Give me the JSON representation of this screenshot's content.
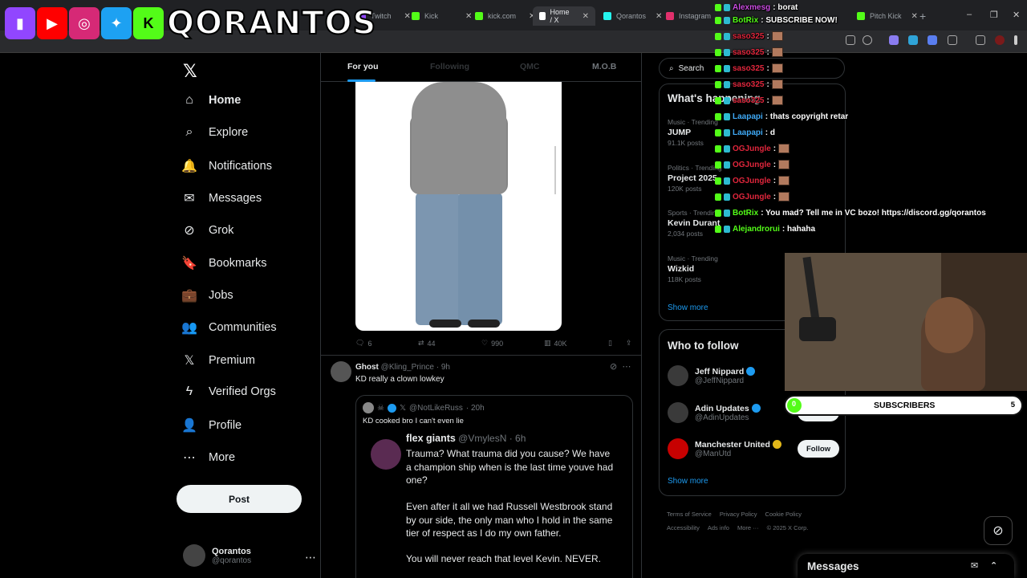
{
  "browser": {
    "tabs": [
      {
        "label": "Twitch",
        "color": "#9146ff"
      },
      {
        "label": "Kick",
        "color": "#53fc18"
      },
      {
        "label": "kick.com",
        "color": "#53fc18"
      },
      {
        "label": "Home / X",
        "color": "#ffffff"
      },
      {
        "label": "Qorantos",
        "color": "#25f4ee"
      },
      {
        "label": "Instagram",
        "color": "#e1306c"
      },
      {
        "label": "Pitch Kick",
        "color": "#53fc18"
      }
    ],
    "new_tab": "+",
    "window_controls": [
      "–",
      "❐",
      "✕"
    ]
  },
  "overlay": {
    "channel_name": "QORANTOS",
    "logos": [
      "twitch-logo",
      "youtube-logo",
      "instagram-logo",
      "twitter-logo",
      "kick-logo"
    ]
  },
  "nav": {
    "logo": "𝕏",
    "items": [
      {
        "label": "Home",
        "icon": "⌂"
      },
      {
        "label": "Explore",
        "icon": "⌕"
      },
      {
        "label": "Notifications",
        "icon": "🔔"
      },
      {
        "label": "Messages",
        "icon": "✉"
      },
      {
        "label": "Grok",
        "icon": "⊘"
      },
      {
        "label": "Bookmarks",
        "icon": "🔖"
      },
      {
        "label": "Jobs",
        "icon": "💼"
      },
      {
        "label": "Communities",
        "icon": "👥"
      },
      {
        "label": "Premium",
        "icon": "𝕏"
      },
      {
        "label": "Verified Orgs",
        "icon": "ϟ"
      },
      {
        "label": "Profile",
        "icon": "👤"
      },
      {
        "label": "More",
        "icon": "⋯"
      }
    ],
    "post_label": "Post",
    "account": {
      "name": "Qorantos",
      "handle": "@qorantos",
      "more": "⋯"
    }
  },
  "feed": {
    "tabs": [
      "For you",
      "Following",
      "QMC",
      "M.O.B"
    ],
    "media_actions": {
      "replies": "6",
      "reposts": "44",
      "likes": "990",
      "views": "40K"
    },
    "tweet": {
      "name": "Ghost",
      "handle": "@Kling_Prince",
      "time": "· 9h",
      "text": "KD really a clown lowkey",
      "quote": {
        "handle": "@NotLikeRuss",
        "time": "· 20h",
        "text": "KD cooked bro I can't even lie",
        "reply": {
          "name": "flex giants",
          "handle": "@VmylesN",
          "time": "· 6h",
          "para1": "Trauma? What trauma did you cause? We have a champion ship when is the last time youve had one?",
          "para2": "Even after it all we had Russell Westbrook stand by our side, the only man who I hold in the same tier of respect as I do my own father.",
          "para3": "You will never reach that level Kevin. NEVER."
        }
      }
    }
  },
  "right": {
    "search_placeholder": "Search",
    "happening_title": "What's happening",
    "trends": [
      {
        "category": "Music · Trending",
        "name": "JUMP",
        "count": "91.1K posts"
      },
      {
        "category": "Politics · Trending",
        "name": "Project 2025",
        "count": "120K posts"
      },
      {
        "category": "Sports · Trending",
        "name": "Kevin Durant",
        "count": "2,034 posts"
      },
      {
        "category": "Music · Trending",
        "name": "Wizkid",
        "count": "118K posts"
      }
    ],
    "show_more": "Show more",
    "wtf_title": "Who to follow",
    "wtf": [
      {
        "name": "Jeff Nippard",
        "handle": "@JeffNippard",
        "follow": "Follow"
      },
      {
        "name": "Adin Updates",
        "handle": "@AdinUpdates",
        "follow": "Follow"
      },
      {
        "name": "Manchester United",
        "handle": "@ManUtd",
        "follow": "Follow"
      }
    ],
    "footer": [
      "Terms of Service",
      "Privacy Policy",
      "Cookie Policy",
      "Accessibility",
      "Ads info",
      "More ···",
      "© 2025 X Corp."
    ],
    "messages_label": "Messages"
  },
  "chat": [
    {
      "user": "Alexmesg",
      "color": "#c94ce0",
      "msg": ": borat"
    },
    {
      "user": "BotRix",
      "color": "#53fc18",
      "msg": ": SUBSCRIBE NOW!"
    },
    {
      "user": "saso325",
      "color": "#e0263c",
      "msg": ":"
    },
    {
      "user": "saso325",
      "color": "#e0263c",
      "msg": ":"
    },
    {
      "user": "saso325",
      "color": "#e0263c",
      "msg": ":"
    },
    {
      "user": "saso325",
      "color": "#e0263c",
      "msg": ":"
    },
    {
      "user": "saso325",
      "color": "#e0263c",
      "msg": ":"
    },
    {
      "user": "Laapapi",
      "color": "#3fa9f5",
      "msg": ": thats copyright retar"
    },
    {
      "user": "Laapapi",
      "color": "#3fa9f5",
      "msg": ": d"
    },
    {
      "user": "OGJungle",
      "color": "#e0263c",
      "msg": ":"
    },
    {
      "user": "OGJungle",
      "color": "#e0263c",
      "msg": ":"
    },
    {
      "user": "OGJungle",
      "color": "#e0263c",
      "msg": ":"
    },
    {
      "user": "OGJungle",
      "color": "#e0263c",
      "msg": ":"
    },
    {
      "user": "BotRix",
      "color": "#53fc18",
      "msg": ": You mad? Tell me in VC bozo! https://discord.gg/qorantos"
    },
    {
      "user": "Alejandrorui",
      "color": "#53fc18",
      "msg": ": hahaha"
    }
  ],
  "subs": {
    "label": "SUBSCRIBERS",
    "count": "0",
    "goal": "5",
    "progress": 0.0
  }
}
